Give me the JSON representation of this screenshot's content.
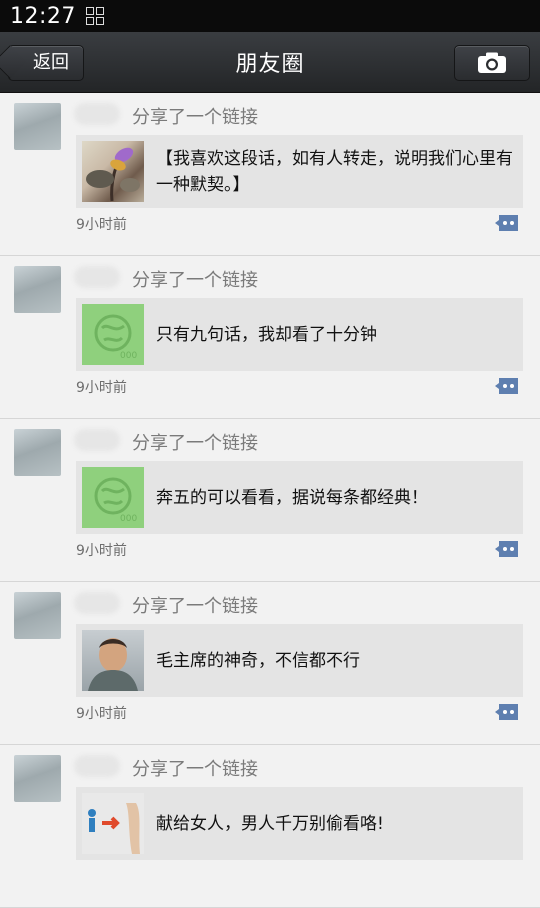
{
  "status_bar": {
    "time": "12:27"
  },
  "nav": {
    "back_label": "返回",
    "title": "朋友圈"
  },
  "posts": [
    {
      "action": "分享了一个链接",
      "link_title": "【我喜欢这段话，如有人转走，说明我们心里有一种默契。】",
      "time": "9小时前"
    },
    {
      "action": "分享了一个链接",
      "link_title": "只有九句话，我却看了十分钟",
      "time": "9小时前"
    },
    {
      "action": "分享了一个链接",
      "link_title": "奔五的可以看看，据说每条都经典！",
      "time": "9小时前"
    },
    {
      "action": "分享了一个链接",
      "link_title": "毛主席的神奇，不信都不行",
      "time": "9小时前"
    },
    {
      "action": "分享了一个链接",
      "link_title": "献给女人，男人千万别偷看咯!",
      "time": ""
    }
  ],
  "colors": {
    "nav_bg": "#2b2d30",
    "page_bg": "#f2f2f2",
    "card_bg": "#e4e4e4",
    "comment_icon": "#5e7fb0"
  }
}
